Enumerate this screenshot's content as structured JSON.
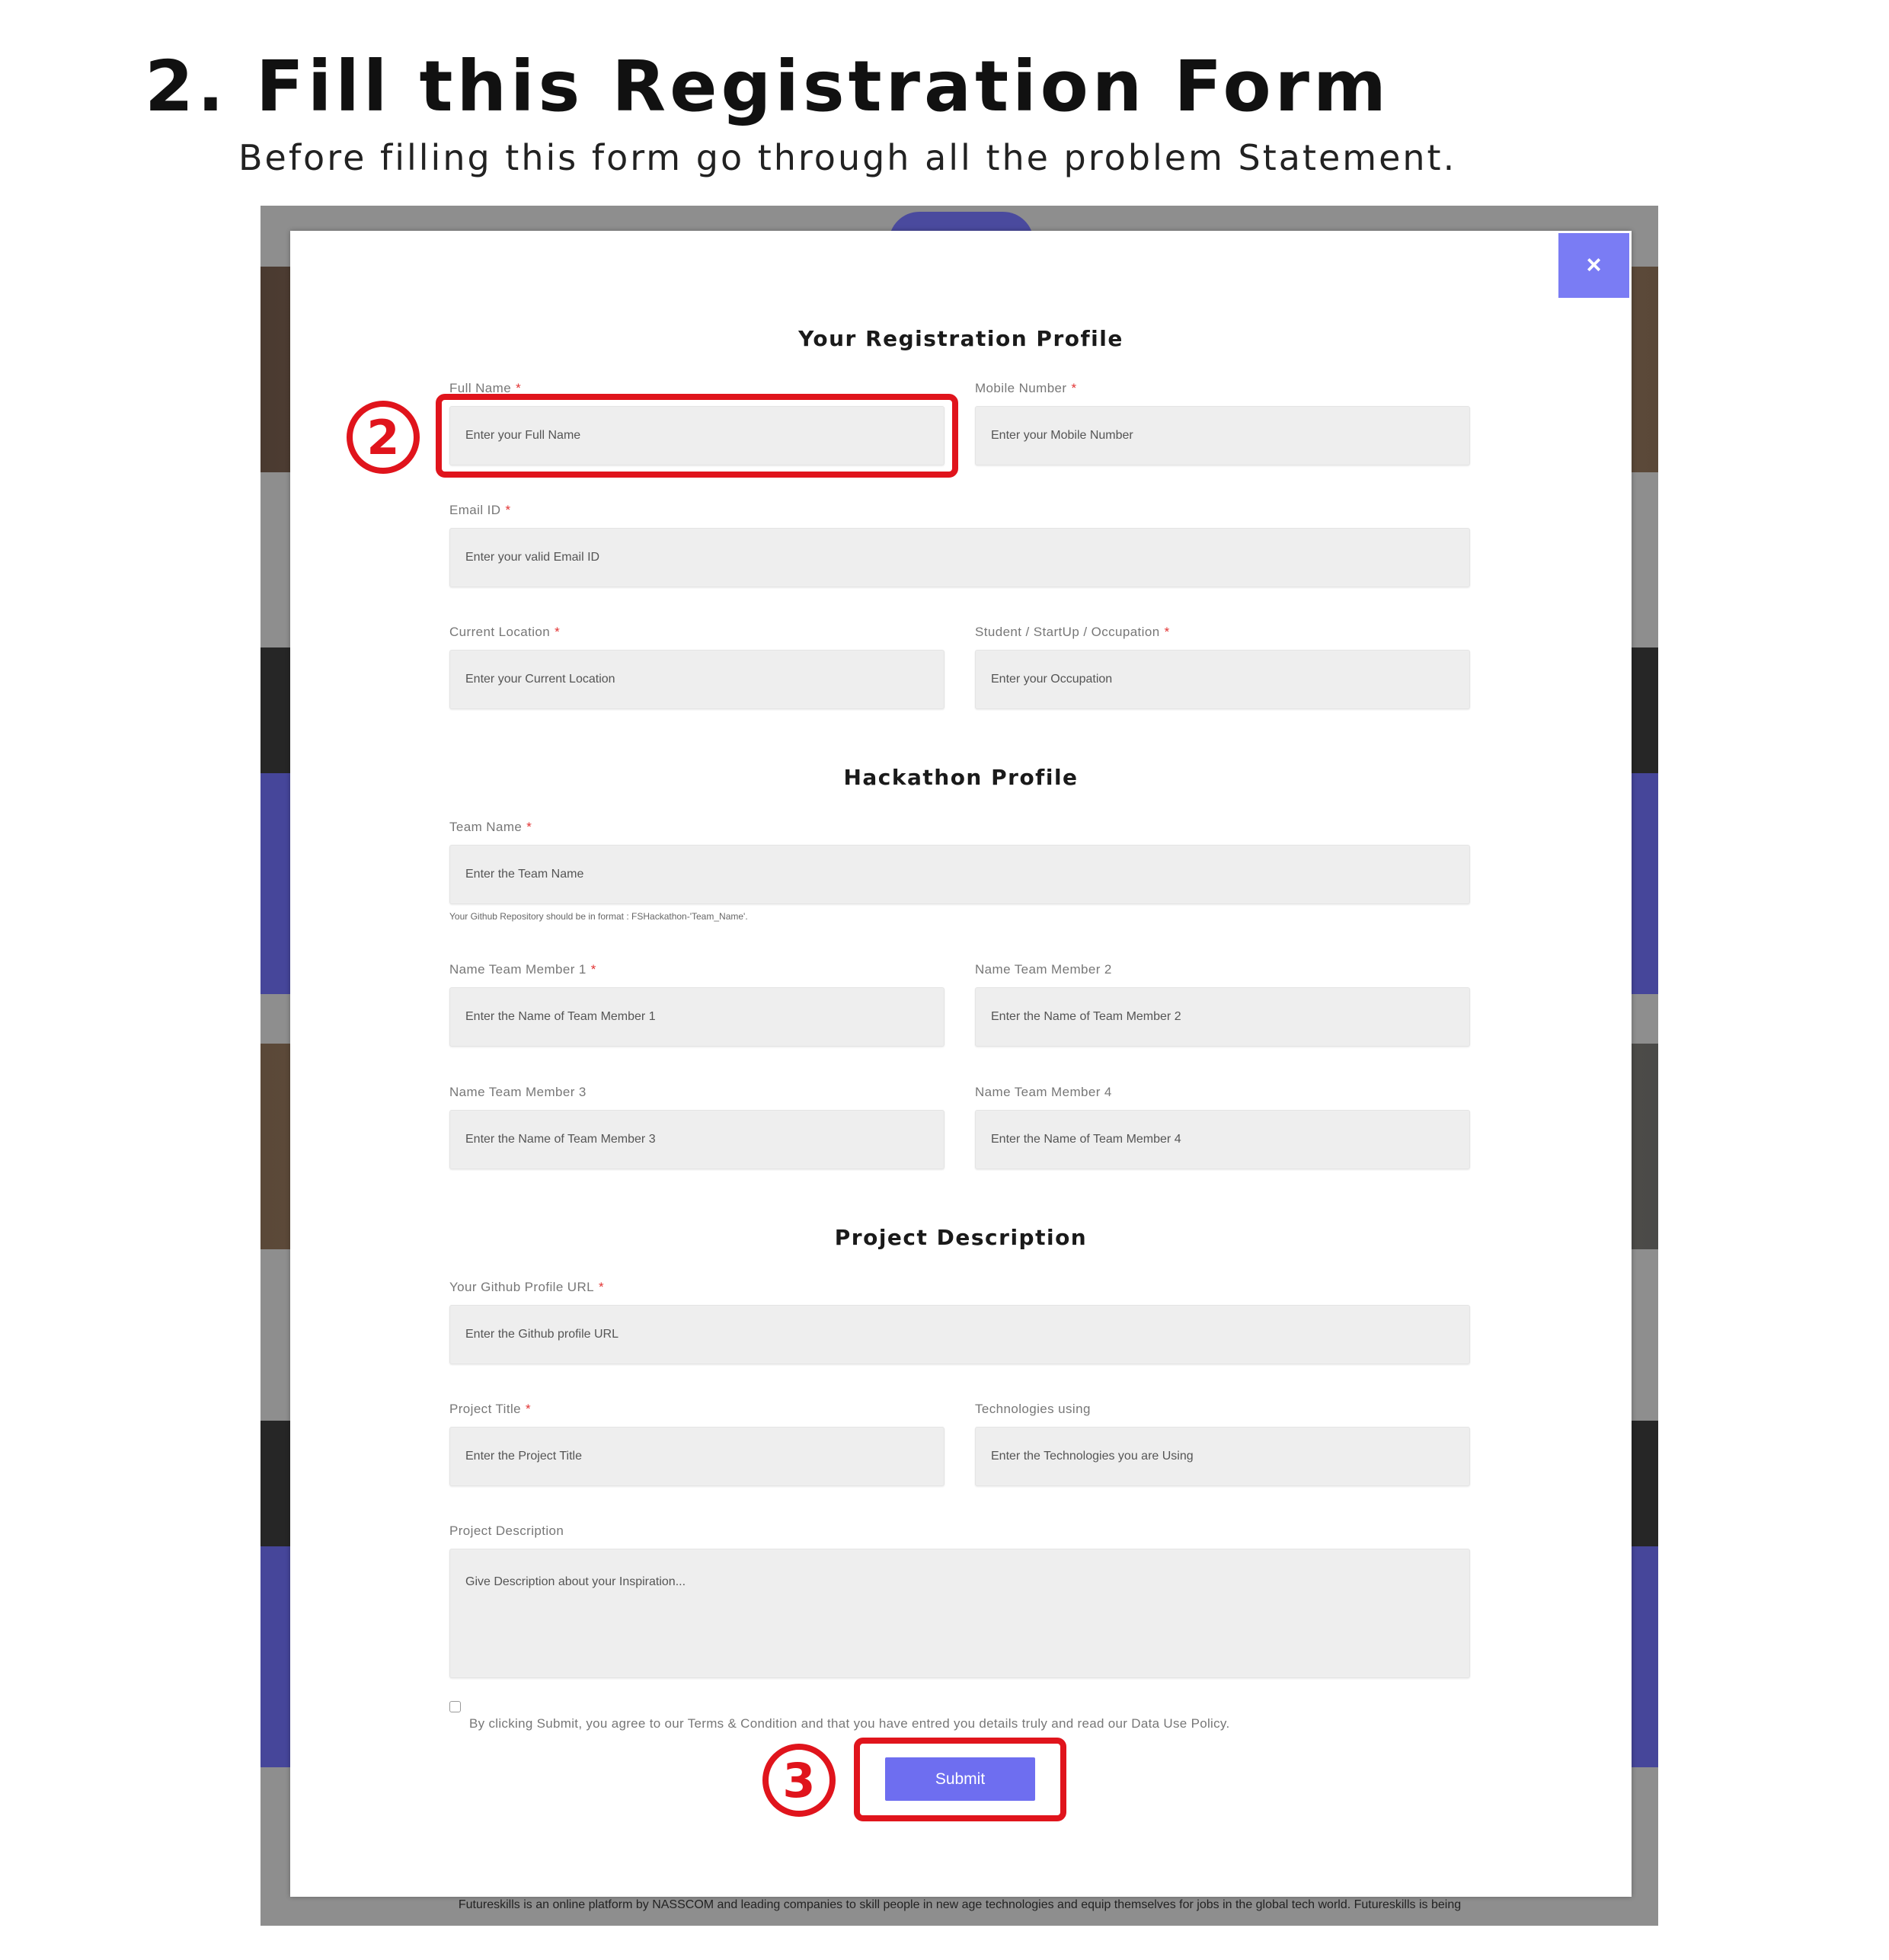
{
  "heading": "2. Fill this Registration Form",
  "subheading": "Before filling this form go through all the problem Statement.",
  "colors": {
    "accent": "#7a7cf4",
    "submit": "#6e6ef0",
    "required": "#e23333",
    "highlight": "#e0141c"
  },
  "modal": {
    "close_label": "×",
    "sections": {
      "registration": "Your Registration Profile",
      "hackathon": "Hackathon Profile",
      "project": "Project Description"
    },
    "fields": {
      "full_name": {
        "label": "Full Name",
        "placeholder": "Enter your Full Name"
      },
      "mobile": {
        "label": "Mobile Number",
        "placeholder": "Enter your Mobile Number"
      },
      "email": {
        "label": "Email ID",
        "placeholder": "Enter your valid Email ID"
      },
      "location": {
        "label": "Current Location",
        "placeholder": "Enter your Current Location"
      },
      "occupation": {
        "label": "Student / StartUp / Occupation",
        "placeholder": "Enter your Occupation"
      },
      "team_name": {
        "label": "Team Name",
        "placeholder": "Enter the Team Name"
      },
      "member1": {
        "label": "Name Team Member 1",
        "placeholder": "Enter the Name of Team Member 1"
      },
      "member2": {
        "label": "Name Team Member 2",
        "placeholder": "Enter the Name of Team Member 2"
      },
      "member3": {
        "label": "Name Team Member 3",
        "placeholder": "Enter the Name of Team Member 3"
      },
      "member4": {
        "label": "Name Team Member 4",
        "placeholder": "Enter the Name of Team Member 4"
      },
      "github": {
        "label": "Your Github Profile URL",
        "placeholder": "Enter the Github profile URL"
      },
      "project_title": {
        "label": "Project Title",
        "placeholder": "Enter the Project Title"
      },
      "technologies": {
        "label": "Technologies using",
        "placeholder": "Enter the Technologies you are Using"
      },
      "description": {
        "label": "Project Description",
        "placeholder": "Give Description about your Inspiration..."
      }
    },
    "required_mark": "*",
    "team_hint": "Your Github Repository should be in format : FSHackathon-'Team_Name'.",
    "terms": "By clicking Submit, you agree to our Terms & Condition and that you have entred you details truly and read our Data Use Policy.",
    "submit_label": "Submit"
  },
  "annotations": {
    "step2": "2",
    "step3": "3"
  },
  "footer": "Futureskills is an online platform by NASSCOM and leading companies to skill people in new age technologies and equip themselves for jobs in the global tech world. Futureskills is being"
}
